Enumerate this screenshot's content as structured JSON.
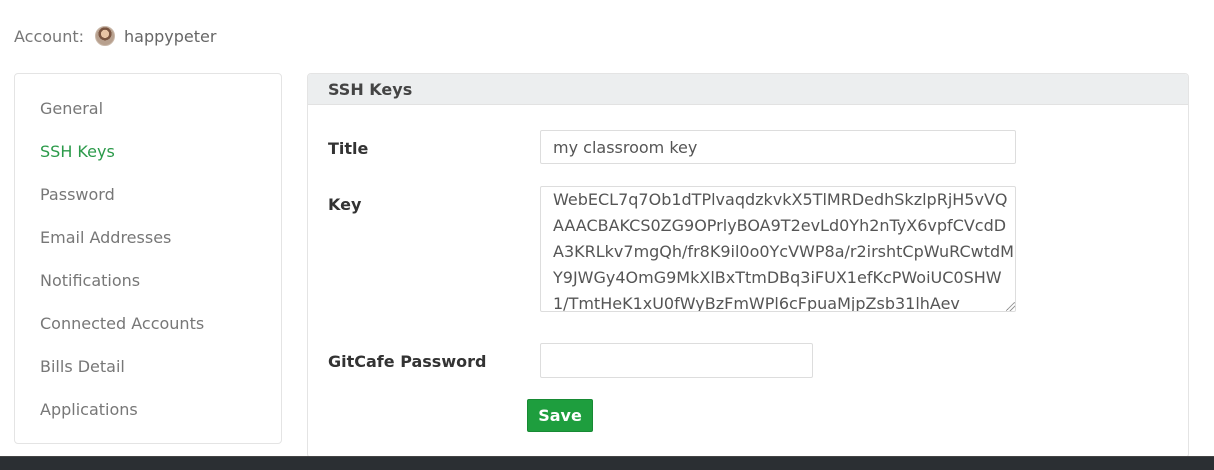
{
  "account": {
    "label": "Account:",
    "username": "happypeter",
    "avatar_icon": "user-avatar"
  },
  "sidebar": {
    "items": [
      {
        "label": "General",
        "active": false
      },
      {
        "label": "SSH Keys",
        "active": true
      },
      {
        "label": "Password",
        "active": false
      },
      {
        "label": "Email Addresses",
        "active": false
      },
      {
        "label": "Notifications",
        "active": false
      },
      {
        "label": "Connected Accounts",
        "active": false
      },
      {
        "label": "Bills Detail",
        "active": false
      },
      {
        "label": "Applications",
        "active": false
      }
    ]
  },
  "panel": {
    "title": "SSH Keys",
    "form": {
      "title_label": "Title",
      "title_value": "my classroom key",
      "key_label": "Key",
      "key_value": "WebECL7q7Ob1dTPlvaqdzkvkX5TlMRDedhSkzlpRjH5vVQAAACBAKCS0ZG9OPrlyBOA9T2evLd0Yh2nTyX6vpfCVcdDA3KRLkv7mgQh/fr8K9il0o0YcVWP8a/r2irshtCpWuRCwtdMY9JWGy4OmG9MkXlBxTtmDBq3iFUX1efKcPWoiUC0SHW1/TmtHeK1xU0fWyBzFmWPl6cFpuaMjpZsb31lhAev",
      "password_label": "GitCafe Password",
      "password_value": "",
      "save_label": "Save"
    }
  },
  "colors": {
    "accent_green": "#2b9a4a",
    "button_green": "#1e9e3e",
    "header_gray": "#eceeef"
  }
}
